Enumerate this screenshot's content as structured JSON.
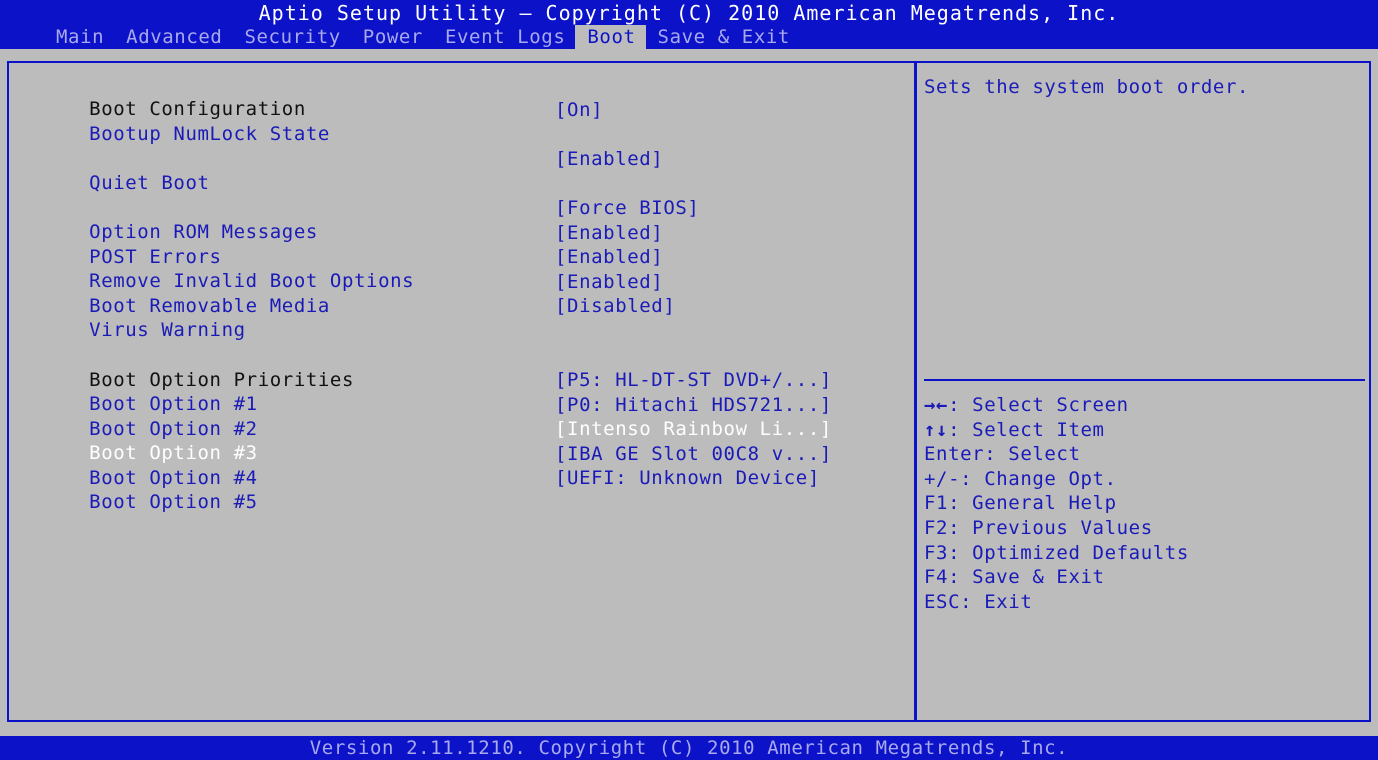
{
  "header": {
    "title": "Aptio Setup Utility – Copyright (C) 2010 American Megatrends, Inc.",
    "tabs": [
      {
        "label": "Main"
      },
      {
        "label": "Advanced"
      },
      {
        "label": "Security"
      },
      {
        "label": "Power"
      },
      {
        "label": "Event Logs"
      },
      {
        "label": "Boot"
      },
      {
        "label": "Save & Exit"
      }
    ],
    "active_tab": "Boot"
  },
  "settings": {
    "boot_configuration_heading": "Boot Configuration",
    "items": [
      {
        "label": "Bootup NumLock State",
        "value": "[On]"
      },
      {
        "label": "Quiet Boot",
        "value": "[Enabled]"
      },
      {
        "label": "Option ROM Messages",
        "value": "[Force BIOS]"
      },
      {
        "label": "POST Errors",
        "value": "[Enabled]"
      },
      {
        "label": "Remove Invalid Boot Options",
        "value": "[Enabled]"
      },
      {
        "label": "Boot Removable Media",
        "value": "[Enabled]"
      },
      {
        "label": "Virus Warning",
        "value": "[Disabled]"
      }
    ],
    "boot_option_priorities_heading": "Boot Option Priorities",
    "boot_options": [
      {
        "label": "Boot Option #1",
        "value": "[P5: HL-DT-ST DVD+/...]"
      },
      {
        "label": "Boot Option #2",
        "value": "[P0: Hitachi HDS721...]"
      },
      {
        "label": "Boot Option #3",
        "value": "[Intenso Rainbow Li...]"
      },
      {
        "label": "Boot Option #4",
        "value": "[IBA GE Slot 00C8 v...]"
      },
      {
        "label": "Boot Option #5",
        "value": "[UEFI: Unknown Device]"
      }
    ],
    "selected_item": "Boot Option #3"
  },
  "help_panel": {
    "text": "Sets the system boot order.",
    "keys": [
      {
        "key": "→←",
        "desc": ": Select Screen"
      },
      {
        "key": "↑↓",
        "desc": ": Select Item"
      },
      {
        "key": "Enter",
        "desc": ": Select"
      },
      {
        "key": "+/-",
        "desc": ": Change Opt."
      },
      {
        "key": "F1",
        "desc": ": General Help"
      },
      {
        "key": "F2",
        "desc": ": Previous Values"
      },
      {
        "key": "F3",
        "desc": ": Optimized Defaults"
      },
      {
        "key": "F4",
        "desc": ": Save & Exit"
      },
      {
        "key": "ESC",
        "desc": ": Exit"
      }
    ]
  },
  "footer": {
    "text": "Version 2.11.1210. Copyright (C) 2010 American Megatrends, Inc."
  },
  "colors": {
    "bios_blue": "#0b12c8",
    "panel_gray": "#bcbcbc",
    "item_blue": "#1a1ab8",
    "selected_white": "#ffffff"
  }
}
